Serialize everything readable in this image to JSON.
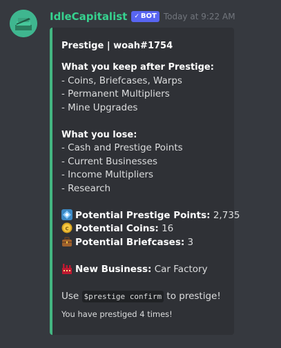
{
  "message": {
    "author": "IdleCapitalist",
    "bot_tag": "BOT",
    "timestamp": "Today at 9:22 AM"
  },
  "embed": {
    "accent_color": "#43b581",
    "title": "Prestige | woah#1754",
    "keep_heading": "What you keep after Prestige:",
    "keep_items": [
      "- Coins, Briefcases, Warps",
      "- Permanent Multipliers",
      "- Mine Upgrades"
    ],
    "lose_heading": "What you lose:",
    "lose_items": [
      "- Cash and Prestige Points",
      "- Current Businesses",
      "- Income Multipliers",
      "- Research"
    ],
    "stats": [
      {
        "icon": "diamond-icon",
        "label": "Potential Prestige Points:",
        "value": "2,735"
      },
      {
        "icon": "coin-icon",
        "label": "Potential Coins:",
        "value": "16"
      },
      {
        "icon": "briefcase-icon",
        "label": "Potential Briefcases:",
        "value": "3"
      }
    ],
    "new_business": {
      "icon": "factory-icon",
      "label": "New Business:",
      "value": "Car Factory"
    },
    "instruction": {
      "before": "Use",
      "command": "$prestige confirm",
      "after": "to prestige!"
    },
    "footer": "You have prestiged 4 times!"
  }
}
